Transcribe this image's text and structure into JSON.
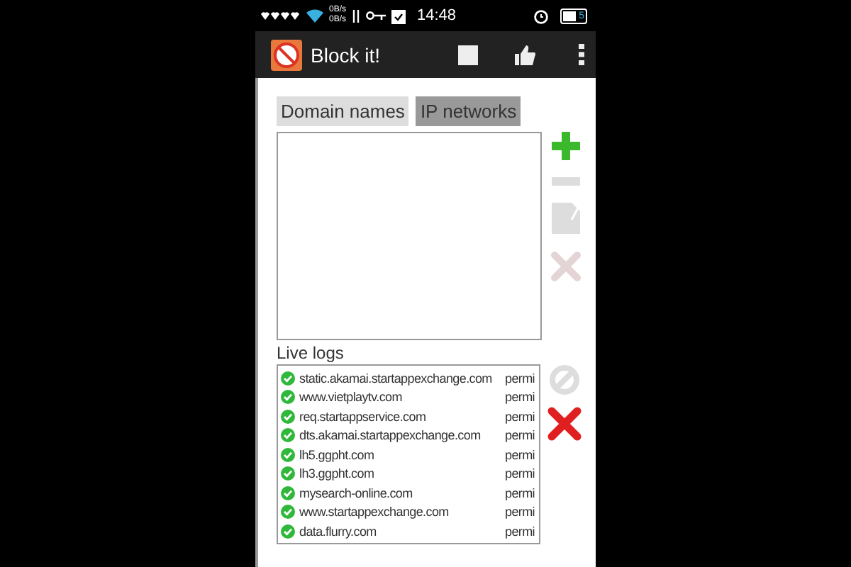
{
  "status_bar": {
    "up_rate": "0B/s",
    "down_rate": "0B/s",
    "time": "14:48",
    "battery": "5"
  },
  "app_bar": {
    "title": "Block it!"
  },
  "tabs": [
    {
      "label": "Domain names",
      "selected": false
    },
    {
      "label": "IP networks",
      "selected": true
    }
  ],
  "list_actions": [
    {
      "kind": "add",
      "enabled": true
    },
    {
      "kind": "remove",
      "enabled": false
    },
    {
      "kind": "edit",
      "enabled": false
    },
    {
      "kind": "delete",
      "enabled": false
    }
  ],
  "live_logs": {
    "label": "Live logs",
    "rows": [
      {
        "domain": "static.akamai.startappexchange.com",
        "action": "permi"
      },
      {
        "domain": "www.vietplaytv.com",
        "action": "permi"
      },
      {
        "domain": "req.startappservice.com",
        "action": "permi"
      },
      {
        "domain": "dts.akamai.startappexchange.com",
        "action": "permi"
      },
      {
        "domain": "lh5.ggpht.com",
        "action": "permi"
      },
      {
        "domain": "lh3.ggpht.com",
        "action": "permi"
      },
      {
        "domain": "mysearch-online.com",
        "action": "permi"
      },
      {
        "domain": "www.startappexchange.com",
        "action": "permi"
      },
      {
        "domain": "data.flurry.com",
        "action": "permi"
      }
    ]
  },
  "log_actions": [
    {
      "kind": "block",
      "enabled": false
    },
    {
      "kind": "clear",
      "enabled": true
    }
  ]
}
